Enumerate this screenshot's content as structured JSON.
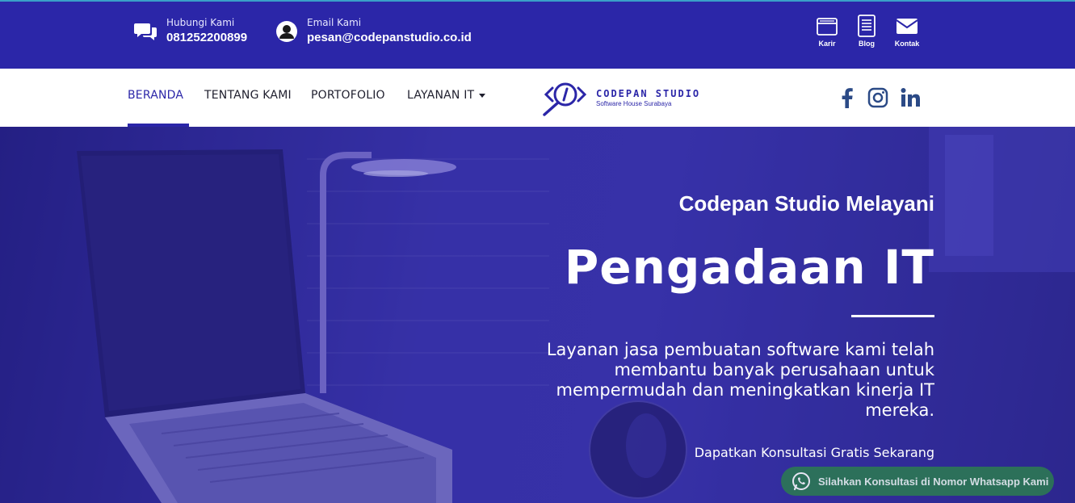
{
  "topbar": {
    "phone_label": "Hubungi Kami",
    "phone_value": "081252200899",
    "email_label": "Email Kami",
    "email_value": "pesan@codepanstudio.co.id",
    "quick_links": [
      {
        "label": "Karir",
        "icon": "folder-icon"
      },
      {
        "label": "Blog",
        "icon": "document-icon"
      },
      {
        "label": "Kontak",
        "icon": "mail-icon"
      }
    ]
  },
  "nav": {
    "items": [
      "BERANDA",
      "TENTANG KAMI",
      "PORTOFOLIO",
      "LAYANAN IT"
    ],
    "active": "BERANDA"
  },
  "logo": {
    "name": "CODEPAN STUDIO",
    "tagline": "Software House Surabaya"
  },
  "social": [
    "facebook-icon",
    "instagram-icon",
    "linkedin-icon"
  ],
  "hero": {
    "subtitle": "Codepan Studio Melayani",
    "title": "Pengadaan IT",
    "description": "Layanan jasa pembuatan software kami telah membantu banyak perusahaan untuk mempermudah dan meningkatkan kinerja IT mereka.",
    "cta": "Dapatkan Konsultasi Gratis Sekarang"
  },
  "whatsapp": {
    "label": "Silahkan Konsultasi di Nomor Whatsapp Kami"
  },
  "colors": {
    "brand": "#2b26a8",
    "whatsapp": "#2c7a52"
  }
}
